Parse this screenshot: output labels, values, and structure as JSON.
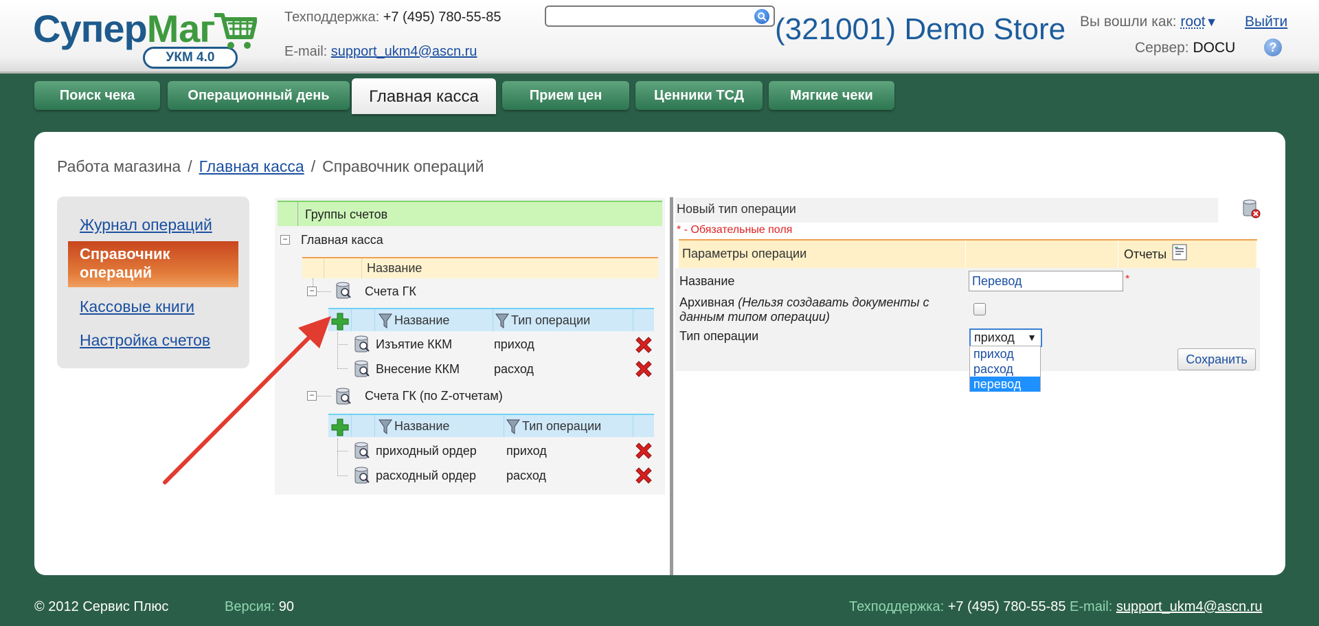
{
  "header": {
    "logo_main_a": "Супер",
    "logo_main_b": "Маг",
    "logo_badge": "УКМ 4.0",
    "support_label": "Техподдержка:",
    "support_phone": "+7 (495) 780-55-85",
    "email_label": "E-mail:",
    "email": "support_ukm4@ascn.ru",
    "search_placeholder": "",
    "store_title": "(321001) Demo Store",
    "login_label": "Вы вошли как:",
    "login_user": "root",
    "logout": "Выйти",
    "server_label": "Сервер:",
    "server_value": "DOCU",
    "help": "?"
  },
  "tabs": [
    {
      "label": "Поиск чека"
    },
    {
      "label": "Операционный день"
    },
    {
      "label": "Главная касса"
    },
    {
      "label": "Прием цен"
    },
    {
      "label": "Ценники ТСД"
    },
    {
      "label": "Мягкие чеки"
    }
  ],
  "breadcrumb": {
    "root": "Работа магазина",
    "link": "Главная касса",
    "current": "Справочник операций",
    "sep": "/"
  },
  "nav": {
    "items": [
      {
        "label": "Журнал операций"
      },
      {
        "label": "Справочник операций"
      },
      {
        "label": "Кассовые книги"
      },
      {
        "label": "Настройка счетов"
      }
    ]
  },
  "tree": {
    "groups_header": "Группы счетов",
    "root_node": "Главная касса",
    "name_header": "Название",
    "col_name": "Название",
    "col_type": "Тип операции",
    "groups": [
      {
        "label": "Счета ГК",
        "rows": [
          {
            "name": "Изъятие ККМ",
            "type": "приход"
          },
          {
            "name": "Внесение ККМ",
            "type": "расход"
          }
        ]
      },
      {
        "label": "Счета ГК (по Z-отчетам)",
        "rows": [
          {
            "name": "приходный ордер",
            "type": "приход"
          },
          {
            "name": "расходный ордер",
            "type": "расход"
          }
        ]
      }
    ]
  },
  "form": {
    "title": "Новый тип операции",
    "required_note": "* - Обязательные поля",
    "params_header": "Параметры операции",
    "reports_label": "Отчеты",
    "name_label": "Название",
    "name_value": "Перевод",
    "archive_label_a": "Архивная ",
    "archive_label_b": "(Нельзя создавать документы с данным типом операции)",
    "type_label": "Тип операции",
    "type_selected": "приход",
    "type_options": [
      "приход",
      "расход",
      "перевод"
    ],
    "save": "Сохранить",
    "star": "*"
  },
  "footer": {
    "copyright": "© 2012 Сервис Плюс",
    "version_label": "Версия:",
    "version": "90",
    "support_label": "Техподдержка:",
    "support_phone": "+7 (495) 780-55-85",
    "email_label": "E-mail:",
    "email": "support_ukm4@ascn.ru"
  },
  "colors": {
    "background": "#2b5e48",
    "tab_green": "#2d7651",
    "link_blue": "#1a4fa0",
    "nav_active": "#d2562a",
    "groups_header_bg": "#ccf5b8",
    "subtable_header_bg": "#cfe9f9",
    "params_header_bg": "#fff0c7",
    "arrow_red": "#e23b30"
  }
}
